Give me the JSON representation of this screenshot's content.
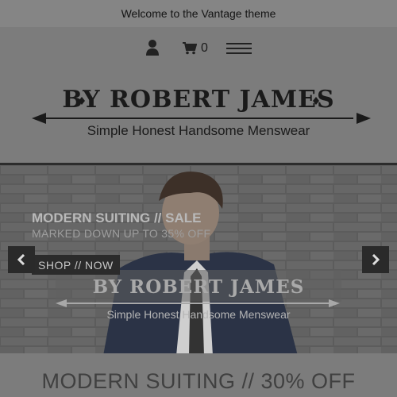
{
  "announcement": "Welcome to the Vantage theme",
  "icons": {
    "user": "user-icon",
    "cart": "cart-icon",
    "menu": "hamburger-menu-icon"
  },
  "cart": {
    "count": "0"
  },
  "brand": {
    "name": "BY ROBERT JAMES",
    "tagline": "Simple Honest Handsome Menswear"
  },
  "hero": {
    "title": "MODERN SUITING // SALE",
    "subtitle": "MARKED DOWN UP TO 35% OFF",
    "button": "SHOP // NOW",
    "overlay_brand": "BY ROBERT JAMES",
    "overlay_tagline": "Simple Honest Handsome Menswear",
    "prev_icon": "chevron-left-icon",
    "next_icon": "chevron-right-icon"
  },
  "promo_heading": "MODERN SUITING // 30% OFF",
  "colors": {
    "page": "#7c7c7c",
    "dark": "#2b2b2b",
    "text": "#1a1a1a"
  }
}
